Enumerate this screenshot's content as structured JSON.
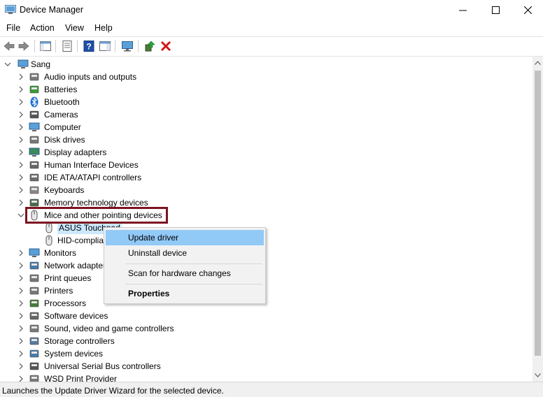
{
  "window": {
    "title": "Device Manager",
    "min_icon": "minimize-icon",
    "max_icon": "maximize-icon",
    "close_icon": "close-icon"
  },
  "menu": [
    "File",
    "Action",
    "View",
    "Help"
  ],
  "toolbar": {
    "icons": [
      "back-arrow-icon",
      "forward-arrow-icon",
      "show-hide-console-tree-icon",
      "properties-icon",
      "help-icon",
      "action-pane-icon",
      "monitor-scan-icon",
      "update-driver-icon",
      "uninstall-device-icon"
    ]
  },
  "tree": {
    "root": "Sang",
    "categories": [
      {
        "label": "Audio inputs and outputs",
        "icon": "speaker-icon"
      },
      {
        "label": "Batteries",
        "icon": "battery-icon"
      },
      {
        "label": "Bluetooth",
        "icon": "bluetooth-icon"
      },
      {
        "label": "Cameras",
        "icon": "camera-icon"
      },
      {
        "label": "Computer",
        "icon": "computer-icon"
      },
      {
        "label": "Disk drives",
        "icon": "disk-drive-icon"
      },
      {
        "label": "Display adapters",
        "icon": "display-adapter-icon"
      },
      {
        "label": "Human Interface Devices",
        "icon": "hid-icon"
      },
      {
        "label": "IDE ATA/ATAPI controllers",
        "icon": "ide-controller-icon"
      },
      {
        "label": "Keyboards",
        "icon": "keyboard-icon"
      },
      {
        "label": "Memory technology devices",
        "icon": "memory-icon"
      },
      {
        "label": "Mice and other pointing devices",
        "icon": "mouse-icon",
        "expanded": true
      },
      {
        "label": "ASUS Touchpad",
        "icon": "mouse-icon",
        "child": true,
        "selected": true
      },
      {
        "label": "HID-compliant mouse",
        "icon": "mouse-icon",
        "child": true
      },
      {
        "label": "Monitors",
        "icon": "monitor-icon"
      },
      {
        "label": "Network adapters",
        "icon": "network-adapter-icon"
      },
      {
        "label": "Print queues",
        "icon": "print-queue-icon"
      },
      {
        "label": "Printers",
        "icon": "printer-icon"
      },
      {
        "label": "Processors",
        "icon": "processor-icon"
      },
      {
        "label": "Software devices",
        "icon": "software-device-icon"
      },
      {
        "label": "Sound, video and game controllers",
        "icon": "speaker-icon"
      },
      {
        "label": "Storage controllers",
        "icon": "storage-controller-icon"
      },
      {
        "label": "System devices",
        "icon": "system-device-icon"
      },
      {
        "label": "Universal Serial Bus controllers",
        "icon": "usb-icon"
      },
      {
        "label": "WSD Print Provider",
        "icon": "printer-icon"
      }
    ]
  },
  "context_menu": {
    "update": "Update driver",
    "uninstall": "Uninstall device",
    "scan": "Scan for hardware changes",
    "properties": "Properties"
  },
  "status": "Launches the Update Driver Wizard for the selected device.",
  "colors": {
    "highlight_box": "#7b1420",
    "menu_hover": "#91c9f7",
    "selection": "#cce8ff"
  }
}
